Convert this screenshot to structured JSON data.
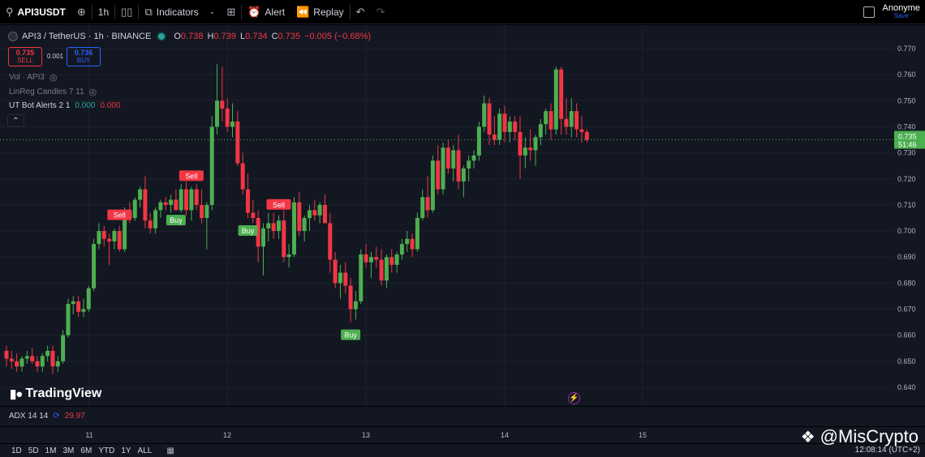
{
  "toolbar": {
    "symbol": "API3USDT",
    "interval": "1h",
    "indicators_label": "Indicators",
    "alert_label": "Alert",
    "replay_label": "Replay",
    "account_name": "Anonyme",
    "account_save": "Save"
  },
  "legend": {
    "title": "API3 / TetherUS · 1h · BINANCE",
    "o_label": "O",
    "o_value": "0.738",
    "h_label": "H",
    "h_value": "0.739",
    "l_label": "L",
    "l_value": "0.734",
    "c_label": "C",
    "c_value": "0.735",
    "change": "−0.005 (−0.68%)"
  },
  "trade": {
    "sell_price": "0.735",
    "sell_label": "SELL",
    "spread": "0.001",
    "buy_price": "0.736",
    "buy_label": "BUY"
  },
  "indicators": {
    "vol": "Vol · API3",
    "linreg": "LinReg Candles 7 11",
    "utbot_name": "UT Bot Alerts 2 1",
    "utbot_v1": "0.000",
    "utbot_v2": "0.000",
    "adx_name": "ADX 14 14",
    "adx_value": "29.97"
  },
  "price_axis": {
    "ticks": [
      "0.770",
      "0.760",
      "0.750",
      "0.740",
      "0.730",
      "0.720",
      "0.710",
      "0.700",
      "0.690",
      "0.680",
      "0.670",
      "0.660",
      "0.650",
      "0.640"
    ],
    "current_price": "0.735",
    "countdown": "51:46"
  },
  "time_axis": {
    "labels": [
      "11",
      "12",
      "13",
      "14",
      "15"
    ]
  },
  "ranges": [
    "1D",
    "5D",
    "1M",
    "3M",
    "6M",
    "YTD",
    "1Y",
    "ALL"
  ],
  "clock": "12:08:14 (UTC+2)",
  "brand": "TradingView",
  "watermark": "@MisCrypto",
  "colors": {
    "up": "#4caf50",
    "down": "#f23645",
    "background": "#131722",
    "accent": "#2962ff"
  },
  "chart_data": {
    "type": "candlestick",
    "ylim": [
      0.636,
      0.774
    ],
    "candles": [
      [
        0.654,
        0.656,
        0.648,
        0.651
      ],
      [
        0.651,
        0.654,
        0.647,
        0.65
      ],
      [
        0.65,
        0.653,
        0.646,
        0.648
      ],
      [
        0.648,
        0.652,
        0.646,
        0.651
      ],
      [
        0.651,
        0.654,
        0.649,
        0.652
      ],
      [
        0.652,
        0.655,
        0.649,
        0.65
      ],
      [
        0.65,
        0.652,
        0.646,
        0.648
      ],
      [
        0.648,
        0.653,
        0.646,
        0.652
      ],
      [
        0.652,
        0.656,
        0.65,
        0.654
      ],
      [
        0.654,
        0.656,
        0.645,
        0.648
      ],
      [
        0.648,
        0.652,
        0.646,
        0.65
      ],
      [
        0.65,
        0.662,
        0.649,
        0.66
      ],
      [
        0.66,
        0.674,
        0.659,
        0.672
      ],
      [
        0.672,
        0.675,
        0.668,
        0.673
      ],
      [
        0.673,
        0.675,
        0.667,
        0.669
      ],
      [
        0.669,
        0.674,
        0.667,
        0.67
      ],
      [
        0.67,
        0.679,
        0.669,
        0.678
      ],
      [
        0.678,
        0.697,
        0.677,
        0.695
      ],
      [
        0.695,
        0.703,
        0.693,
        0.7
      ],
      [
        0.7,
        0.702,
        0.694,
        0.697
      ],
      [
        0.697,
        0.699,
        0.687,
        0.696
      ],
      [
        0.696,
        0.701,
        0.693,
        0.7
      ],
      [
        0.7,
        0.702,
        0.692,
        0.693
      ],
      [
        0.693,
        0.709,
        0.692,
        0.707
      ],
      [
        0.707,
        0.711,
        0.703,
        0.705
      ],
      [
        0.705,
        0.713,
        0.704,
        0.712
      ],
      [
        0.712,
        0.717,
        0.709,
        0.716
      ],
      [
        0.716,
        0.721,
        0.701,
        0.704
      ],
      [
        0.704,
        0.707,
        0.699,
        0.701
      ],
      [
        0.701,
        0.709,
        0.699,
        0.708
      ],
      [
        0.708,
        0.712,
        0.705,
        0.711
      ],
      [
        0.711,
        0.713,
        0.708,
        0.71
      ],
      [
        0.71,
        0.714,
        0.707,
        0.712
      ],
      [
        0.712,
        0.716,
        0.709,
        0.708
      ],
      [
        0.708,
        0.718,
        0.707,
        0.716
      ],
      [
        0.716,
        0.719,
        0.706,
        0.708
      ],
      [
        0.708,
        0.717,
        0.704,
        0.716
      ],
      [
        0.716,
        0.718,
        0.708,
        0.71
      ],
      [
        0.71,
        0.716,
        0.703,
        0.705
      ],
      [
        0.705,
        0.711,
        0.693,
        0.71
      ],
      [
        0.71,
        0.744,
        0.708,
        0.74
      ],
      [
        0.74,
        0.764,
        0.737,
        0.75
      ],
      [
        0.75,
        0.763,
        0.742,
        0.747
      ],
      [
        0.747,
        0.751,
        0.738,
        0.74
      ],
      [
        0.74,
        0.749,
        0.736,
        0.742
      ],
      [
        0.742,
        0.746,
        0.725,
        0.726
      ],
      [
        0.726,
        0.73,
        0.714,
        0.716
      ],
      [
        0.716,
        0.722,
        0.705,
        0.707
      ],
      [
        0.707,
        0.712,
        0.703,
        0.705
      ],
      [
        0.705,
        0.708,
        0.688,
        0.694
      ],
      [
        0.694,
        0.703,
        0.683,
        0.701
      ],
      [
        0.701,
        0.707,
        0.696,
        0.703
      ],
      [
        0.703,
        0.707,
        0.697,
        0.7
      ],
      [
        0.7,
        0.706,
        0.697,
        0.704
      ],
      [
        0.704,
        0.708,
        0.688,
        0.69
      ],
      [
        0.69,
        0.695,
        0.686,
        0.691
      ],
      [
        0.691,
        0.713,
        0.69,
        0.711
      ],
      [
        0.711,
        0.715,
        0.698,
        0.7
      ],
      [
        0.7,
        0.706,
        0.696,
        0.705
      ],
      [
        0.705,
        0.71,
        0.7,
        0.708
      ],
      [
        0.708,
        0.712,
        0.704,
        0.706
      ],
      [
        0.706,
        0.711,
        0.703,
        0.71
      ],
      [
        0.71,
        0.714,
        0.705,
        0.703
      ],
      [
        0.703,
        0.707,
        0.684,
        0.689
      ],
      [
        0.689,
        0.692,
        0.678,
        0.68
      ],
      [
        0.68,
        0.687,
        0.674,
        0.684
      ],
      [
        0.684,
        0.688,
        0.676,
        0.679
      ],
      [
        0.679,
        0.682,
        0.665,
        0.67
      ],
      [
        0.67,
        0.677,
        0.666,
        0.673
      ],
      [
        0.673,
        0.693,
        0.672,
        0.691
      ],
      [
        0.691,
        0.695,
        0.686,
        0.688
      ],
      [
        0.688,
        0.692,
        0.682,
        0.69
      ],
      [
        0.69,
        0.694,
        0.686,
        0.689
      ],
      [
        0.689,
        0.693,
        0.679,
        0.681
      ],
      [
        0.681,
        0.691,
        0.678,
        0.69
      ],
      [
        0.69,
        0.693,
        0.684,
        0.687
      ],
      [
        0.687,
        0.692,
        0.684,
        0.691
      ],
      [
        0.691,
        0.697,
        0.689,
        0.695
      ],
      [
        0.695,
        0.7,
        0.692,
        0.697
      ],
      [
        0.697,
        0.699,
        0.69,
        0.693
      ],
      [
        0.693,
        0.707,
        0.692,
        0.705
      ],
      [
        0.705,
        0.716,
        0.704,
        0.713
      ],
      [
        0.713,
        0.721,
        0.705,
        0.708
      ],
      [
        0.708,
        0.729,
        0.707,
        0.727
      ],
      [
        0.727,
        0.733,
        0.714,
        0.716
      ],
      [
        0.716,
        0.734,
        0.714,
        0.732
      ],
      [
        0.732,
        0.735,
        0.722,
        0.724
      ],
      [
        0.724,
        0.733,
        0.719,
        0.731
      ],
      [
        0.731,
        0.737,
        0.716,
        0.719
      ],
      [
        0.719,
        0.725,
        0.713,
        0.724
      ],
      [
        0.724,
        0.729,
        0.719,
        0.727
      ],
      [
        0.727,
        0.731,
        0.724,
        0.729
      ],
      [
        0.729,
        0.742,
        0.727,
        0.74
      ],
      [
        0.74,
        0.752,
        0.738,
        0.749
      ],
      [
        0.749,
        0.751,
        0.733,
        0.737
      ],
      [
        0.737,
        0.744,
        0.733,
        0.735
      ],
      [
        0.735,
        0.747,
        0.733,
        0.745
      ],
      [
        0.745,
        0.748,
        0.734,
        0.738
      ],
      [
        0.738,
        0.744,
        0.734,
        0.742
      ],
      [
        0.742,
        0.744,
        0.735,
        0.738
      ],
      [
        0.738,
        0.744,
        0.72,
        0.729
      ],
      [
        0.729,
        0.736,
        0.724,
        0.732
      ],
      [
        0.732,
        0.739,
        0.727,
        0.731
      ],
      [
        0.731,
        0.737,
        0.725,
        0.736
      ],
      [
        0.736,
        0.743,
        0.733,
        0.741
      ],
      [
        0.741,
        0.747,
        0.737,
        0.746
      ],
      [
        0.746,
        0.749,
        0.735,
        0.739
      ],
      [
        0.739,
        0.763,
        0.737,
        0.762
      ],
      [
        0.762,
        0.763,
        0.737,
        0.743
      ],
      [
        0.743,
        0.751,
        0.737,
        0.74
      ],
      [
        0.74,
        0.751,
        0.736,
        0.746
      ],
      [
        0.746,
        0.749,
        0.736,
        0.739
      ],
      [
        0.739,
        0.744,
        0.734,
        0.738
      ],
      [
        0.738,
        0.739,
        0.734,
        0.735
      ]
    ],
    "signals": [
      {
        "index": 22,
        "label": "Sell",
        "type": "sell"
      },
      {
        "index": 33,
        "label": "Buy",
        "type": "buy"
      },
      {
        "index": 36,
        "label": "Sell",
        "type": "sell"
      },
      {
        "index": 47,
        "label": "Buy",
        "type": "buy"
      },
      {
        "index": 53,
        "label": "Sell",
        "type": "sell"
      },
      {
        "index": 67,
        "label": "Buy",
        "type": "buy"
      }
    ]
  }
}
